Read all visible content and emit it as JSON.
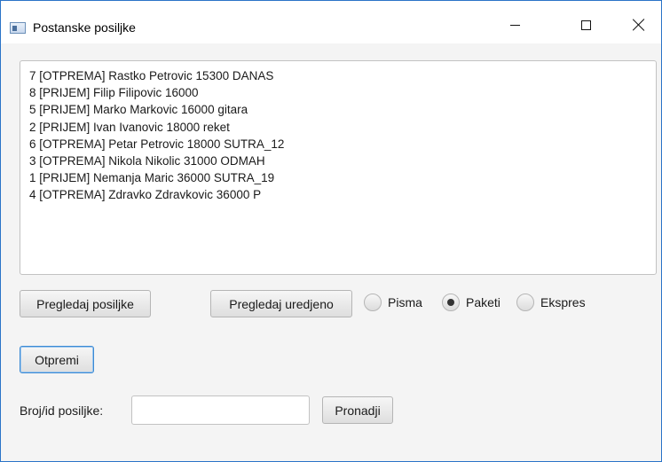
{
  "window": {
    "title": "Postanske posiljke"
  },
  "list": {
    "items": [
      "7 [OTPREMA] Rastko Petrovic 15300 DANAS",
      "8 [PRIJEM] Filip Filipovic 16000",
      "5 [PRIJEM] Marko Markovic 16000 gitara",
      "2 [PRIJEM] Ivan Ivanovic 18000 reket",
      "6 [OTPREMA] Petar Petrovic 18000 SUTRA_12",
      "3 [OTPREMA] Nikola Nikolic 31000 ODMAH",
      "1 [PRIJEM] Nemanja Maric 36000 SUTRA_19",
      "4 [OTPREMA] Zdravko Zdravkovic 36000 P"
    ]
  },
  "controls": {
    "pregledaj_label": "Pregledaj posiljke",
    "pregledaj_uredjeno_label": "Pregledaj uredjeno",
    "otpremi_label": "Otpremi",
    "pronadji_label": "Pronadji",
    "radios": {
      "pisma": "Pisma",
      "paketi": "Paketi",
      "ekspres": "Ekspres",
      "selected": "Paketi"
    }
  },
  "search": {
    "label": "Broj/id posiljke:",
    "value": "",
    "placeholder": ""
  }
}
